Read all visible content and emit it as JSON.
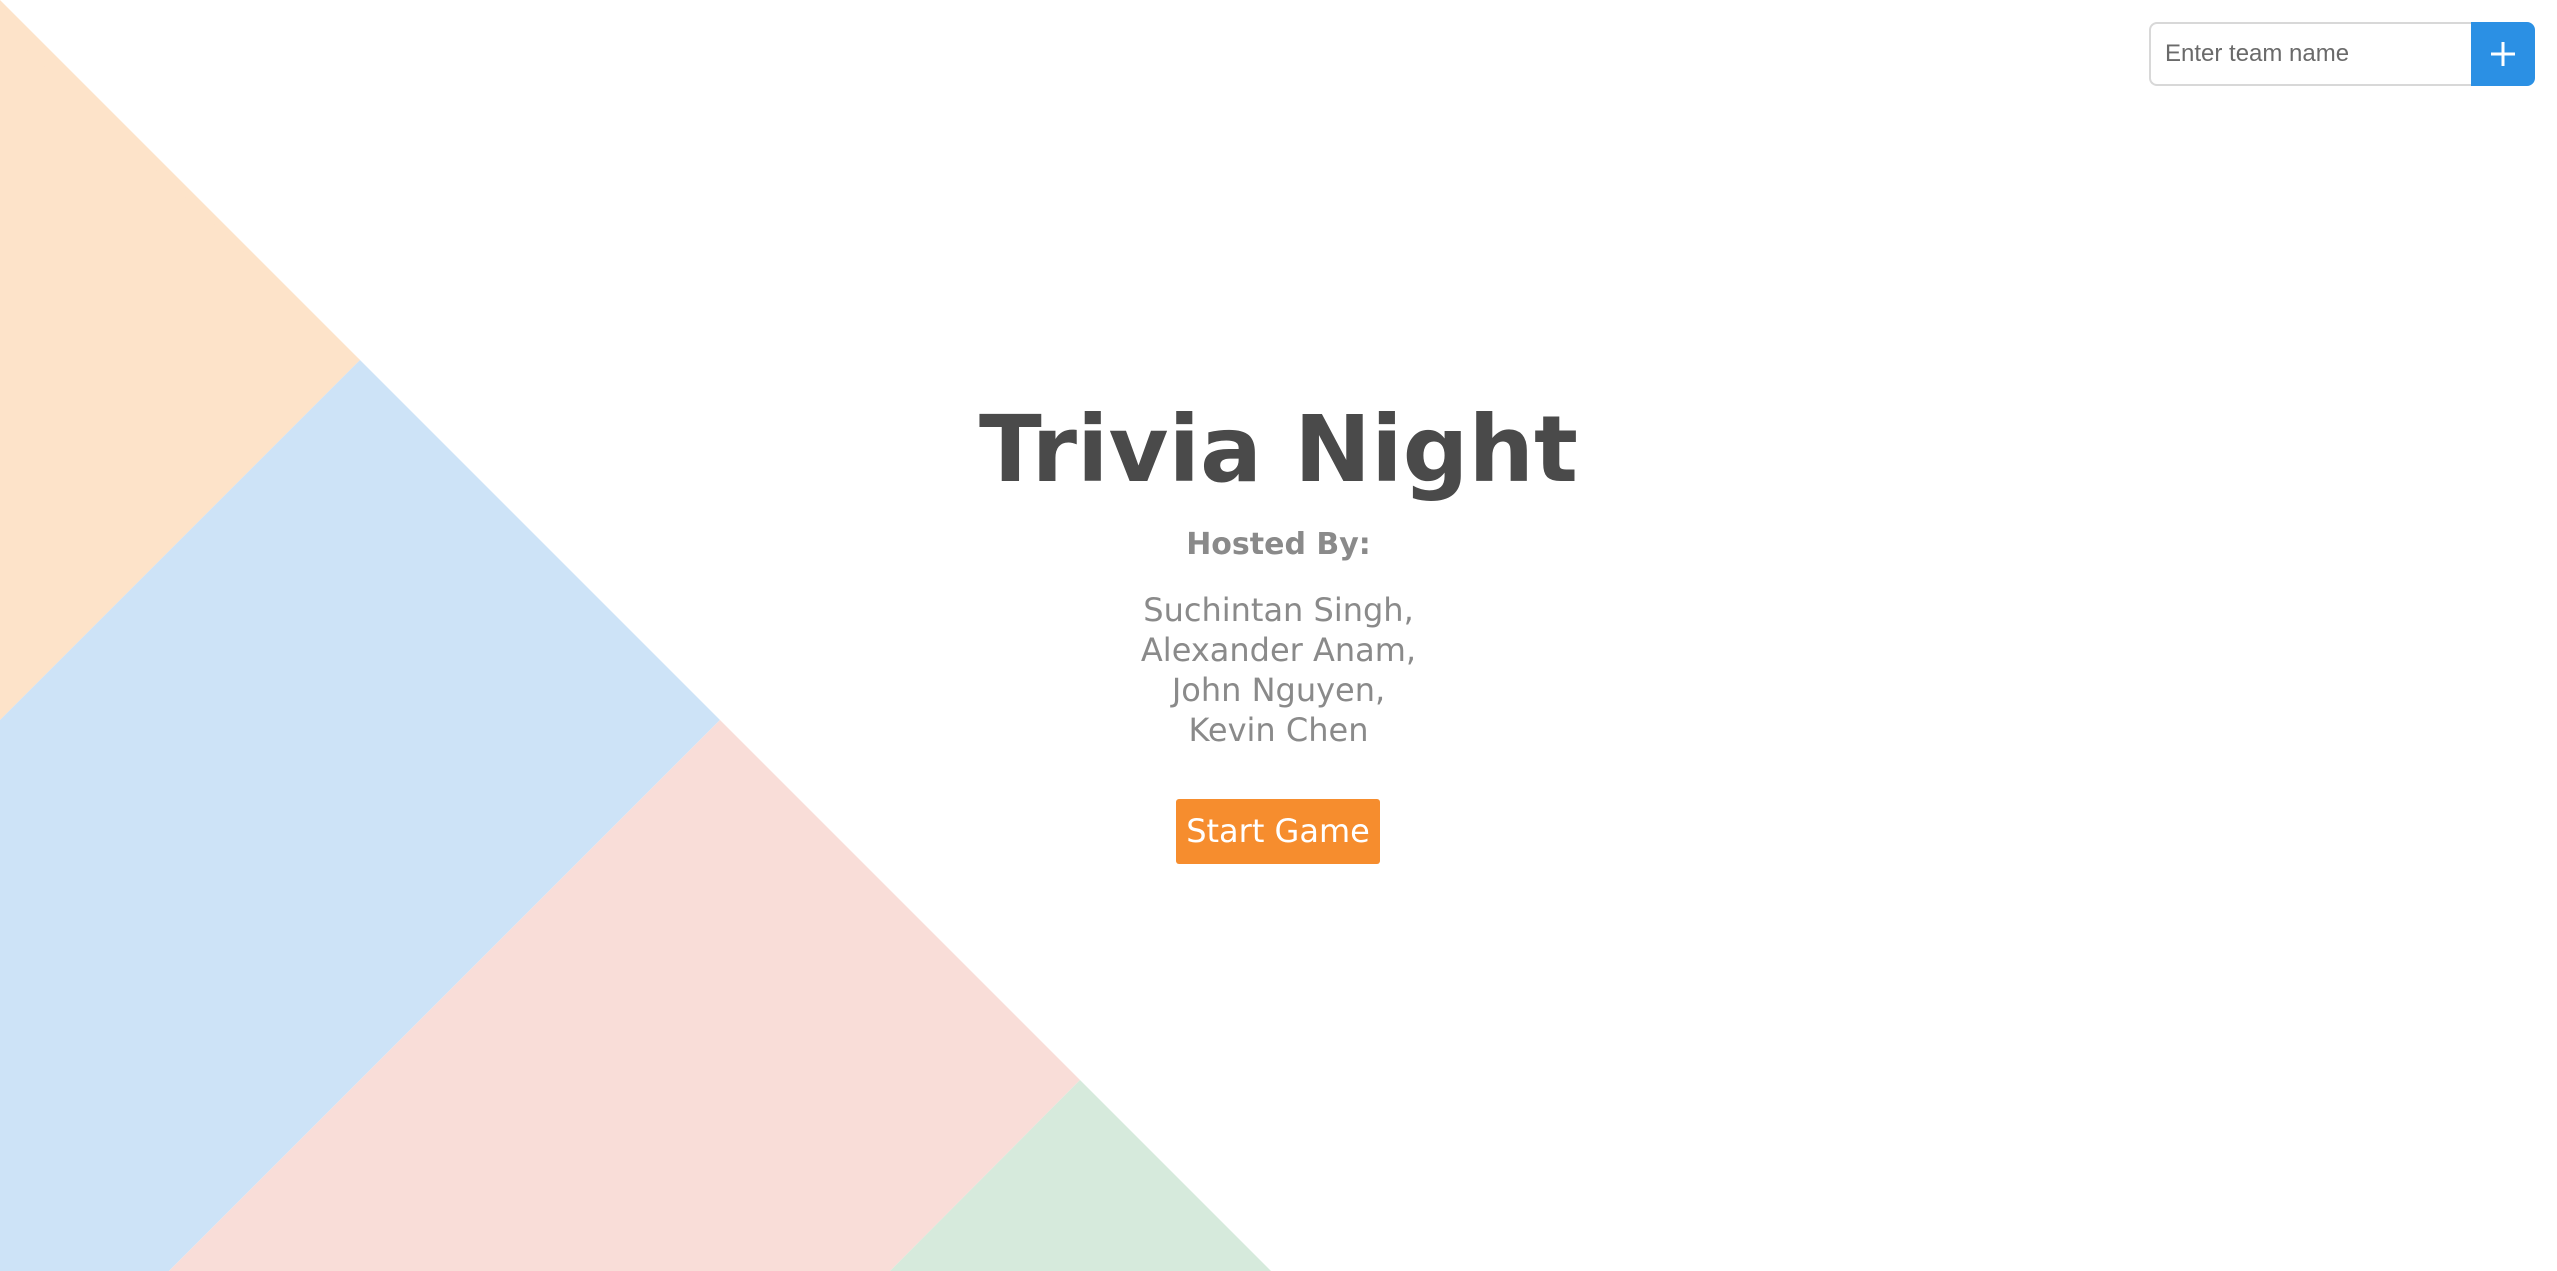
{
  "team_form": {
    "input_placeholder": "Enter team name",
    "input_value": "",
    "add_button_icon": "plus-icon"
  },
  "hero": {
    "title": "Trivia Night",
    "hosted_by_label": "Hosted By:",
    "hosts": [
      "Suchintan Singh,",
      "Alexander Anam,",
      "John Nguyen,",
      "Kevin Chen"
    ],
    "start_button_label": "Start Game"
  },
  "colors": {
    "accent_blue": "#2b90e4",
    "accent_orange": "#f68d2e",
    "title_text": "#4a4a4a",
    "muted_text": "#8a8a8a",
    "band_peach": "#fde3c9",
    "band_blue": "#cde3f7",
    "band_pink": "#f9ddd8",
    "band_green": "#d6eadc"
  }
}
